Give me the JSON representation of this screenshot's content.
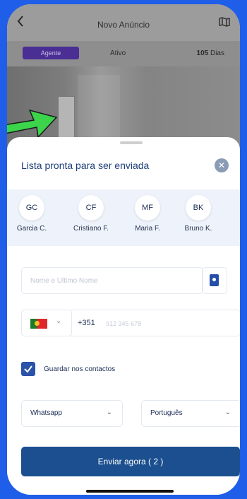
{
  "header": {
    "title": "Novo Anúncio"
  },
  "listing_status": {
    "agent_label": "Agente",
    "status_label": "Ativo",
    "days_value": "105",
    "days_label": "Dias"
  },
  "sheet": {
    "title": "Lista pronta para ser enviada",
    "close_symbol": "✕"
  },
  "contacts": [
    {
      "initials": "GC",
      "name": "Garcia C."
    },
    {
      "initials": "CF",
      "name": "Cristiano F."
    },
    {
      "initials": "MF",
      "name": "Maria F."
    },
    {
      "initials": "BK",
      "name": "Bruno K."
    }
  ],
  "form": {
    "name_placeholder": "Nome e Último Nome",
    "dial_code": "+351",
    "phone_placeholder": "912 345 678",
    "country_chevron": "⌄",
    "save_contact_checked": true,
    "save_contact_label": "Guardar nos contactos",
    "channel_value": "Whatsapp",
    "language_value": "Português",
    "dropdown_chevron": "⌄"
  },
  "actions": {
    "send_label": "Enviar agora ( 2 )"
  },
  "colors": {
    "accent": "#1b4f8f",
    "checkbox": "#2a53a9",
    "arrow": "#3bd44a",
    "background": "#1f5ee8"
  },
  "icons": {
    "back": "chevron-left-icon",
    "map": "map-icon",
    "close": "close-icon",
    "contacts_book": "contacts-book-icon",
    "flag": "portugal-flag-icon",
    "check": "check-icon"
  }
}
